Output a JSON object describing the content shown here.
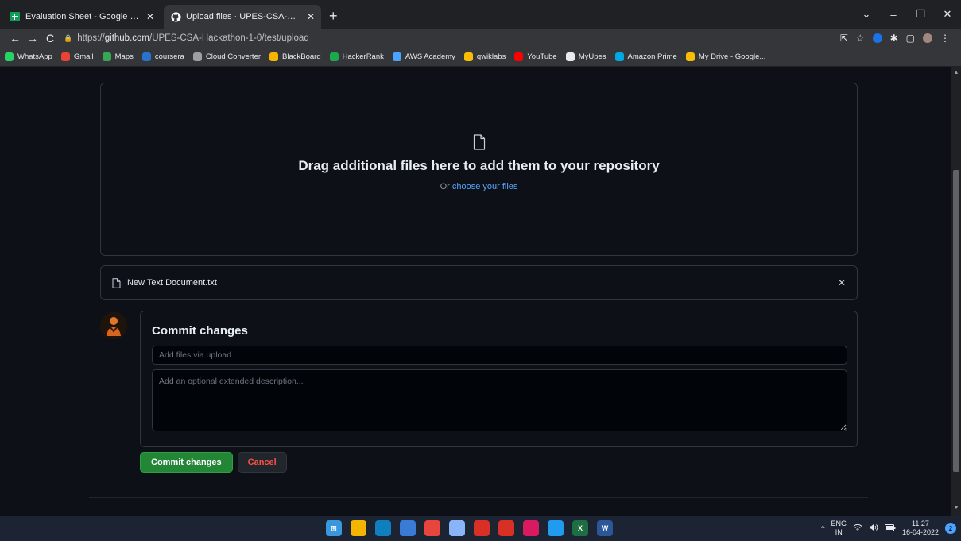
{
  "browser": {
    "tabs": [
      {
        "title": "Evaluation Sheet - Google Sheets",
        "active": false,
        "favicon_color": "#0f9d58"
      },
      {
        "title": "Upload files · UPES-CSA-Hackath",
        "active": true,
        "favicon_color": "#ffffff"
      }
    ],
    "new_tab": "+",
    "window_controls": {
      "chevron": "⌄",
      "minimize": "–",
      "restore": "❐",
      "close": "✕"
    },
    "nav": {
      "back": "←",
      "forward": "→",
      "reload": "C"
    },
    "url": {
      "scheme": "https://",
      "host": "github.com",
      "path": "/UPES-CSA-Hackathon-1-0/test/upload"
    },
    "bookmarks": [
      {
        "label": "WhatsApp",
        "color": "#25d366"
      },
      {
        "label": "Gmail",
        "color": "#ea4335"
      },
      {
        "label": "Maps",
        "color": "#34a853"
      },
      {
        "label": "coursera",
        "color": "#2a73cc"
      },
      {
        "label": "Cloud Converter",
        "color": "#9aa0a6"
      },
      {
        "label": "BlackBoard",
        "color": "#f4b400"
      },
      {
        "label": "HackerRank",
        "color": "#1ba94c"
      },
      {
        "label": "AWS Academy",
        "color": "#4aa3ff"
      },
      {
        "label": "qwiklabs",
        "color": "#fbbc04"
      },
      {
        "label": "YouTube",
        "color": "#ff0000"
      },
      {
        "label": "MyUpes",
        "color": "#e8eaed"
      },
      {
        "label": "Amazon Prime",
        "color": "#00a8e1"
      },
      {
        "label": "My Drive - Google...",
        "color": "#fbbc04"
      }
    ]
  },
  "upload": {
    "drop_title": "Drag additional files here to add them to your repository",
    "drop_or": "Or",
    "drop_link": "choose your files",
    "file_name": "New Text Document.txt",
    "remove": "✕"
  },
  "commit": {
    "heading": "Commit changes",
    "summary_placeholder": "Add files via upload",
    "description_placeholder": "Add an optional extended description...",
    "commit_button": "Commit changes",
    "cancel_button": "Cancel"
  },
  "taskbar": {
    "apps": [
      {
        "name": "start",
        "color": "#3a96dd",
        "glyph": "⊞"
      },
      {
        "name": "file-explorer",
        "color": "#f4b400",
        "glyph": ""
      },
      {
        "name": "edge",
        "color": "#0f7fc0",
        "glyph": ""
      },
      {
        "name": "store",
        "color": "#3a7bd5",
        "glyph": ""
      },
      {
        "name": "chrome",
        "color": "#e8453c",
        "glyph": ""
      },
      {
        "name": "app-6",
        "color": "#8ab4f8",
        "glyph": ""
      },
      {
        "name": "acrobat",
        "color": "#d93025",
        "glyph": ""
      },
      {
        "name": "app-8",
        "color": "#d93025",
        "glyph": ""
      },
      {
        "name": "app-9",
        "color": "#d81b60",
        "glyph": ""
      },
      {
        "name": "vscode",
        "color": "#1f9cf0",
        "glyph": ""
      },
      {
        "name": "excel",
        "color": "#1d6f42",
        "glyph": "X"
      },
      {
        "name": "word",
        "color": "#2b579a",
        "glyph": "W"
      }
    ],
    "tray": {
      "caret": "^",
      "lang_top": "ENG",
      "lang_bottom": "IN",
      "time": "11:27",
      "date": "16-04-2022",
      "notifications": "2"
    }
  }
}
